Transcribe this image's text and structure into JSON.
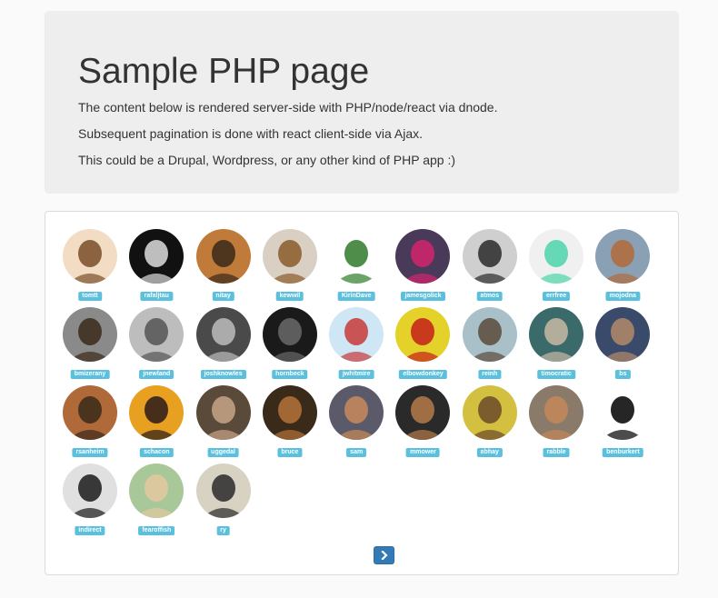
{
  "header": {
    "title": "Sample PHP page",
    "paragraphs": [
      "The content below is rendered server-side with PHP/node/react via dnode.",
      "Subsequent pagination is done with react client-side via Ajax.",
      "This could be a Drupal, Wordpress, or any other kind of PHP app :)"
    ]
  },
  "users": [
    {
      "name": "tomtt",
      "colors": [
        "#f2dcc4",
        "#7a4e2a"
      ]
    },
    {
      "name": "rafaljtau",
      "colors": [
        "#111111",
        "#dddddd"
      ]
    },
    {
      "name": "nitay",
      "colors": [
        "#c07a3a",
        "#3a2a1a"
      ]
    },
    {
      "name": "kewwil",
      "colors": [
        "#d9cfc3",
        "#8a5a2a"
      ]
    },
    {
      "name": "KirinDave",
      "colors": [
        "#ffffff",
        "#2f7a2a"
      ]
    },
    {
      "name": "jamesgolick",
      "colors": [
        "#4a3a5a",
        "#d4246f"
      ]
    },
    {
      "name": "atmos",
      "colors": [
        "#cfcfcf",
        "#2a2a2a"
      ]
    },
    {
      "name": "errfree",
      "colors": [
        "#f0f0f0",
        "#4cd4aa"
      ]
    },
    {
      "name": "mojodna",
      "colors": [
        "#8aa0b4",
        "#b06a3a"
      ]
    },
    {
      "name": "bmizerany",
      "colors": [
        "#8a8a8a",
        "#3a2a1a"
      ]
    },
    {
      "name": "jnewland",
      "colors": [
        "#bdbdbd",
        "#555555"
      ]
    },
    {
      "name": "joshknowles",
      "colors": [
        "#4a4a4a",
        "#bcbcbc"
      ]
    },
    {
      "name": "hornbeck",
      "colors": [
        "#1a1a1a",
        "#6a6a6a"
      ]
    },
    {
      "name": "jwhitmire",
      "colors": [
        "#cfe6f4",
        "#c8393a"
      ]
    },
    {
      "name": "elbowdonkey",
      "colors": [
        "#e4d22a",
        "#c4201a"
      ]
    },
    {
      "name": "reinh",
      "colors": [
        "#aac0c8",
        "#5a4a3a"
      ]
    },
    {
      "name": "timocratic",
      "colors": [
        "#3a6a6a",
        "#c9b8a4"
      ]
    },
    {
      "name": "bs",
      "colors": [
        "#3a4a6a",
        "#b48a6a"
      ]
    },
    {
      "name": "rsanheim",
      "colors": [
        "#b06a3a",
        "#3a2a1a"
      ]
    },
    {
      "name": "schacon",
      "colors": [
        "#e8a020",
        "#2a1a1a"
      ]
    },
    {
      "name": "uggedal",
      "colors": [
        "#5a4a3a",
        "#c8a488"
      ]
    },
    {
      "name": "bruce",
      "colors": [
        "#3a2a1a",
        "#b4723a"
      ]
    },
    {
      "name": "sam",
      "colors": [
        "#5a5a6a",
        "#c88a5a"
      ]
    },
    {
      "name": "mmower",
      "colors": [
        "#2a2a2a",
        "#b47a4a"
      ]
    },
    {
      "name": "abhay",
      "colors": [
        "#d4c040",
        "#6a4a2a"
      ]
    },
    {
      "name": "rabble",
      "colors": [
        "#8a7a6a",
        "#c4885a"
      ]
    },
    {
      "name": "benburkert",
      "colors": [
        "#ffffff",
        "#000000"
      ]
    },
    {
      "name": "indirect",
      "colors": [
        "#e0e0e0",
        "#1a1a1a"
      ]
    },
    {
      "name": "fearoffish",
      "colors": [
        "#a8c89a",
        "#e4c8a0"
      ]
    },
    {
      "name": "ry",
      "colors": [
        "#d8d2c2",
        "#2a2a2a"
      ]
    }
  ],
  "pagination": {
    "next_label": "›",
    "next_icon": "chevron-right-icon",
    "button_color": "#337ab7"
  },
  "colors": {
    "badge": "#5bc0de",
    "jumbotron_bg": "#eeeeee"
  }
}
